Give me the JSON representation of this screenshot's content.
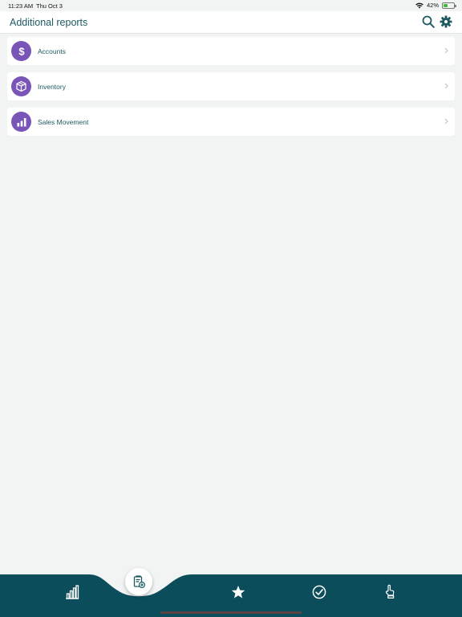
{
  "status_bar": {
    "time": "11:23 AM",
    "date": "Thu Oct 3",
    "battery_percent": "42%",
    "battery_level": 0.42,
    "wifi_icon": "wifi-icon"
  },
  "header": {
    "title": "Additional reports",
    "search_icon": "search-icon",
    "settings_icon": "gear-icon"
  },
  "reports": [
    {
      "label": "Accounts",
      "icon": "dollar-icon"
    },
    {
      "label": "Inventory",
      "icon": "box-icon"
    },
    {
      "label": "Sales Movement",
      "icon": "bar-chart-icon"
    }
  ],
  "tab_bar": {
    "tabs": [
      {
        "icon": "bar-chart-icon"
      },
      {
        "icon": "add-report-icon",
        "selected": true
      },
      {
        "icon": "star-icon"
      },
      {
        "icon": "check-circle-icon"
      },
      {
        "icon": "touch-icon"
      }
    ]
  },
  "colors": {
    "accent": "#1d5a63",
    "tab_bar_bg": "#0b4d5a",
    "report_icon_bg": "#7a55b8",
    "background": "#f2f3f3"
  }
}
